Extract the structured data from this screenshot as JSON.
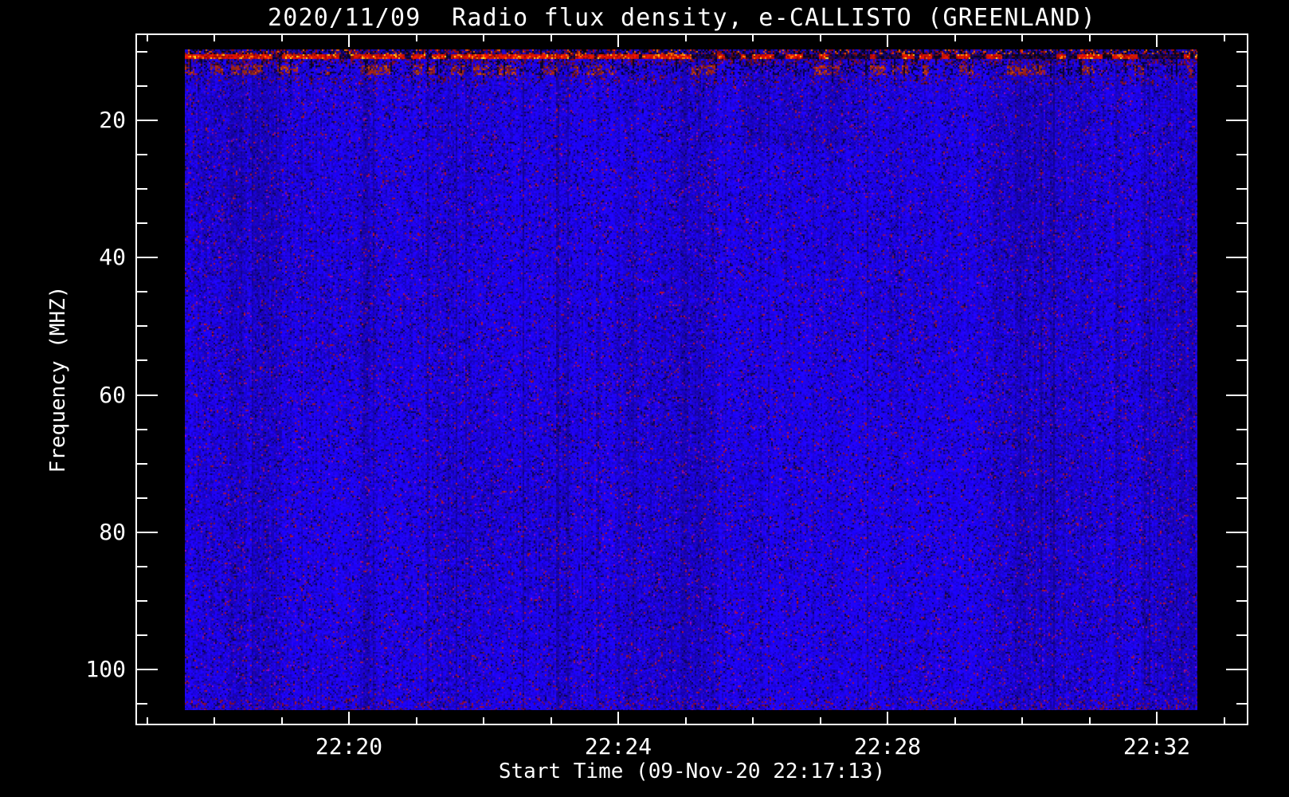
{
  "figure": {
    "title": "2020/11/09  Radio flux density, e-CALLISTO (GREENLAND)",
    "x_axis_label": "Start Time (09-Nov-20 22:17:13)",
    "y_axis_label": "Frequency (MHZ)"
  },
  "chart_data": {
    "type": "heatmap",
    "subtype": "solar radio spectrogram",
    "instrument": "e-CALLISTO",
    "station": "GREENLAND",
    "date": "2020/11/09",
    "title": "2020/11/09  Radio flux density, e-CALLISTO (GREENLAND)",
    "xlabel": "Start Time (09-Nov-20 22:17:13)",
    "ylabel": "Frequency (MHZ)",
    "x_tick_labels": [
      "22:20",
      "22:24",
      "22:28",
      "22:32"
    ],
    "x_minor_tick_interval_minutes": 1,
    "y_tick_values_mhz": [
      20,
      40,
      60,
      80,
      100
    ],
    "y_minor_tick_interval_mhz": 5,
    "y_axis_inverted": true,
    "x_start_time": "22:17:13",
    "x_end_time_approx": "22:32:50",
    "frequency_span_mhz": [
      10,
      106
    ],
    "axis_frame_span": {
      "time": [
        "22:16:52",
        "22:33:22"
      ],
      "frequency_mhz": [
        7.5,
        108
      ]
    },
    "grid": false,
    "legend": false,
    "background_color": "#000000",
    "axis_color": "#ffffff",
    "palette": {
      "noise_blue_bright": "#2e2ef8",
      "noise_blue_mid": "#1c1cd6",
      "noise_blue_dark": "#0a0a7a",
      "speck_purple": "#6e1ac8",
      "speck_maroon": "#8e1c48",
      "speck_dark_red": "#9c1a20",
      "rfi_red": "#dc1a00",
      "rfi_orange": "#ff7800",
      "rfi_yellow": "#ffd824",
      "rfi_dark_red": "#8c1c10",
      "gap_black": "#000000",
      "gap_navy": "#000078"
    },
    "features": [
      "Uniform blue background noise over ~10-106 MHz with fine vertical column striping and scattered purple/maroon specks",
      "Strong intermittent red RFI band near 10-11 MHz with orange/yellow peaks, nearly continuous before ~22:22 and broken into dark segments afterwards",
      "Weaker mottled dark-red RFI band near 12-14 MHz, fading toward the right half",
      "Occasional dark vertical dropout streaks in the upper rows",
      "No solar radio burst visible; quiet spectrum"
    ]
  }
}
